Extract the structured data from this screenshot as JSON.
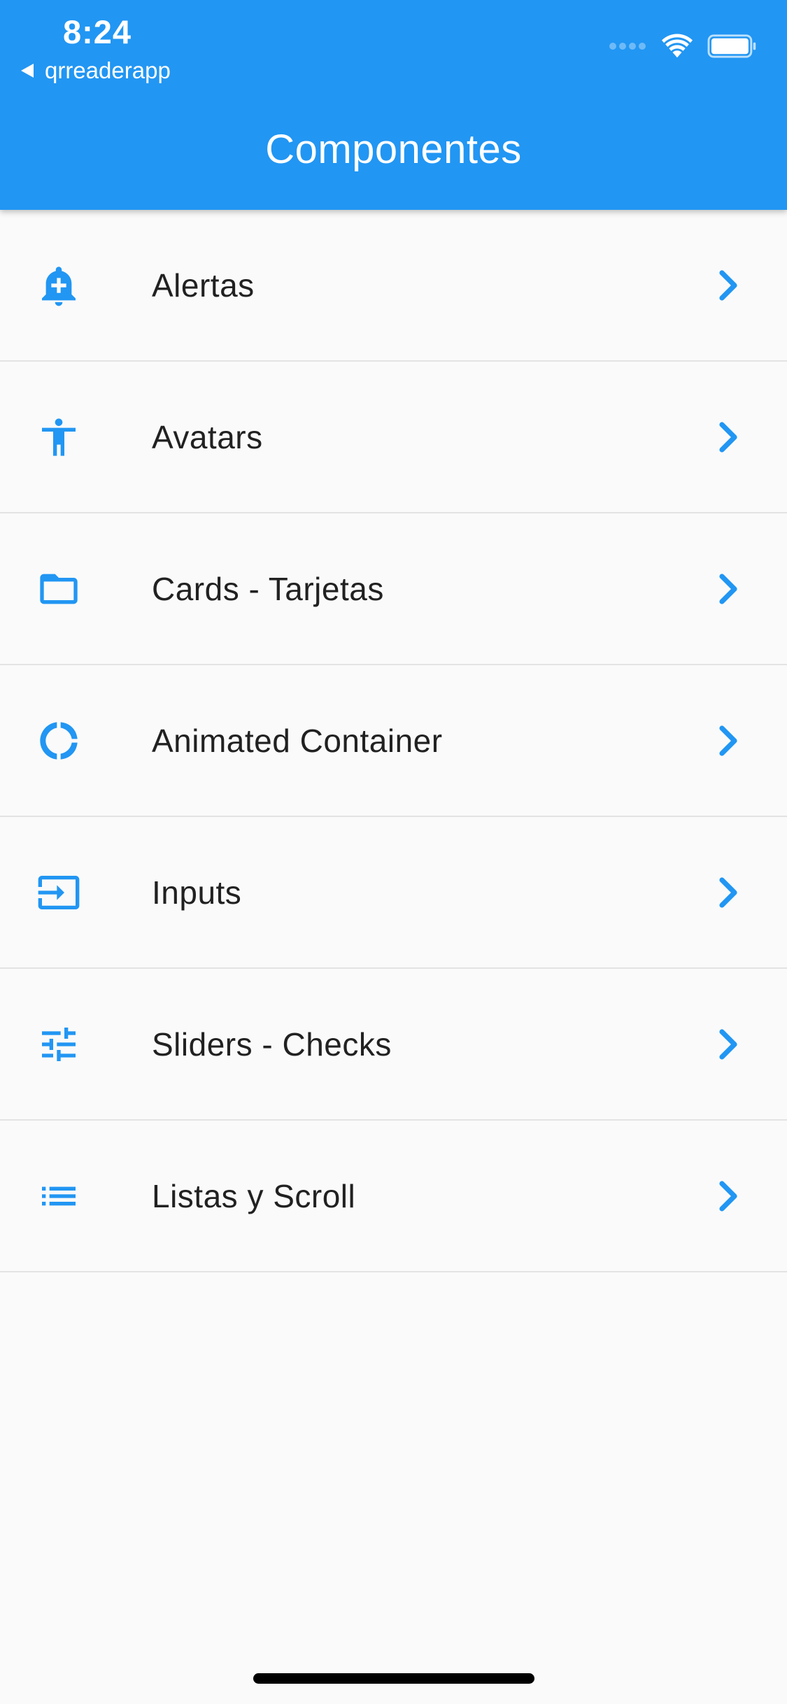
{
  "status_bar": {
    "time": "8:24",
    "back_app": "qrreaderapp"
  },
  "app_bar": {
    "title": "Componentes",
    "color": "#2196f3"
  },
  "items": [
    {
      "label": "Alertas",
      "icon": "add-alert-icon"
    },
    {
      "label": "Avatars",
      "icon": "accessibility-icon"
    },
    {
      "label": "Cards - Tarjetas",
      "icon": "folder-open-icon"
    },
    {
      "label": "Animated Container",
      "icon": "donut-large-icon"
    },
    {
      "label": "Inputs",
      "icon": "input-icon"
    },
    {
      "label": "Sliders - Checks",
      "icon": "tune-icon"
    },
    {
      "label": "Listas y Scroll",
      "icon": "list-icon"
    }
  ],
  "accent_color": "#2196f3"
}
